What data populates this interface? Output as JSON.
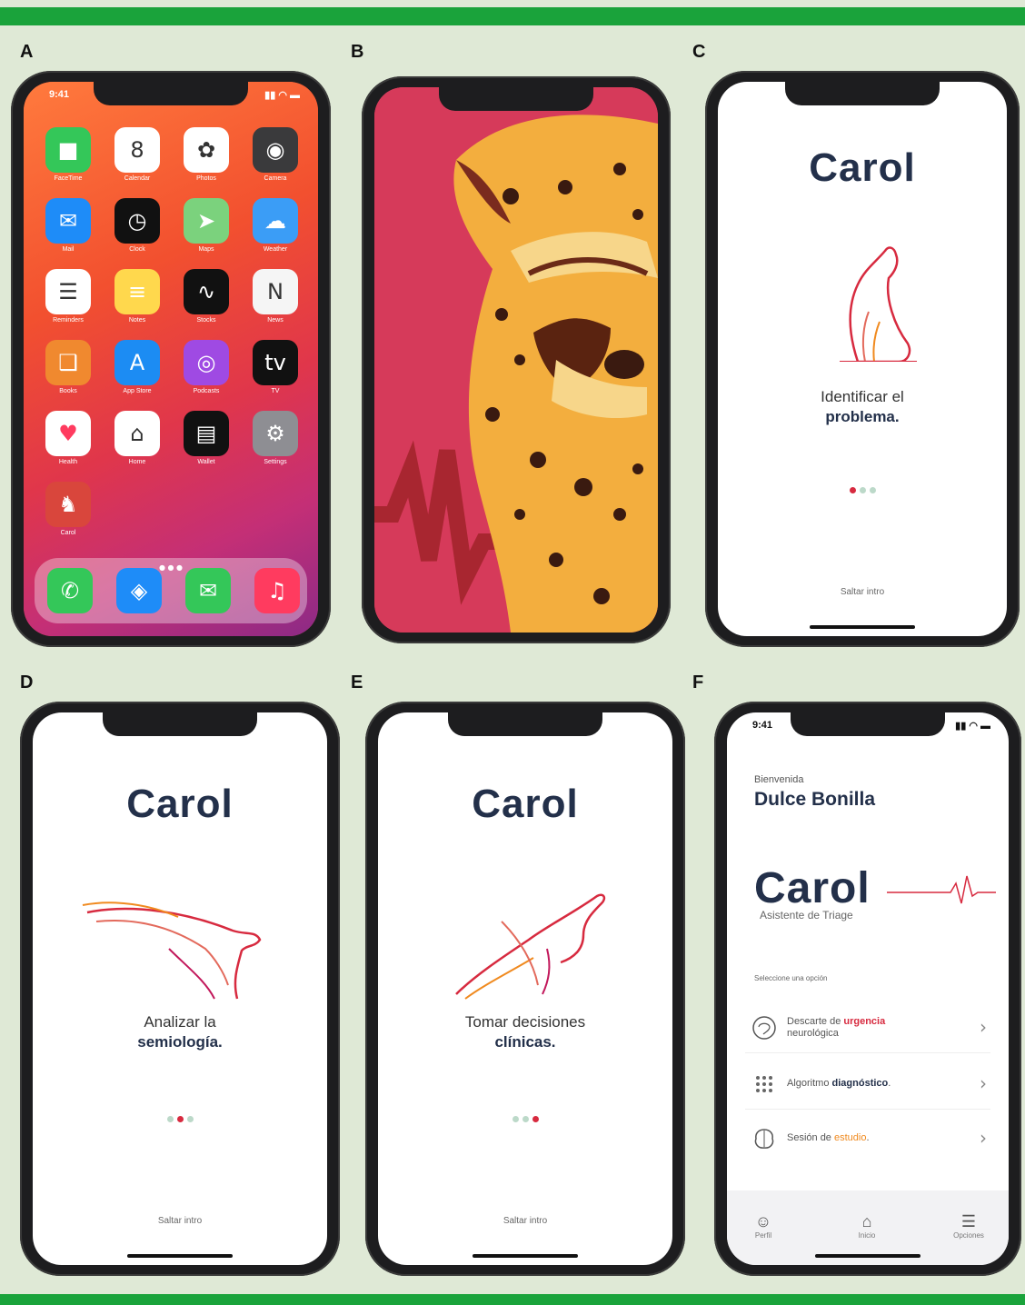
{
  "panels": {
    "a": {
      "letter": "A"
    },
    "b": {
      "letter": "B"
    },
    "c": {
      "letter": "C",
      "title": "Carol",
      "caption_line1": "Identificar el",
      "caption_line2": "problema.",
      "skip": "Saltar intro"
    },
    "d": {
      "letter": "D",
      "title": "Carol",
      "caption_line1": "Analizar la",
      "caption_line2": "semiología.",
      "skip": "Saltar intro"
    },
    "e": {
      "letter": "E",
      "title": "Carol",
      "caption_line1": "Tomar decisiones",
      "caption_line2": "clínicas.",
      "skip": "Saltar intro"
    },
    "f": {
      "letter": "F"
    }
  },
  "homescreen": {
    "time": "9:41",
    "apps": [
      {
        "label": "FaceTime",
        "icon": "video-camera-icon",
        "color": "#34c759"
      },
      {
        "label": "Calendar",
        "icon": "calendar-icon",
        "color": "#ffffff",
        "text": "8"
      },
      {
        "label": "Photos",
        "icon": "photos-icon",
        "color": "#ffffff"
      },
      {
        "label": "Camera",
        "icon": "camera-icon",
        "color": "#3a3a3c"
      },
      {
        "label": "Mail",
        "icon": "mail-icon",
        "color": "#1e8cf8"
      },
      {
        "label": "Clock",
        "icon": "clock-icon",
        "color": "#111111"
      },
      {
        "label": "Maps",
        "icon": "maps-icon",
        "color": "#7bd27d"
      },
      {
        "label": "Weather",
        "icon": "weather-icon",
        "color": "#3b9df6"
      },
      {
        "label": "Reminders",
        "icon": "reminders-icon",
        "color": "#ffffff"
      },
      {
        "label": "Notes",
        "icon": "notes-icon",
        "color": "#ffd84d"
      },
      {
        "label": "Stocks",
        "icon": "stocks-icon",
        "color": "#111111"
      },
      {
        "label": "News",
        "icon": "news-icon",
        "color": "#f5f5f5"
      },
      {
        "label": "Books",
        "icon": "books-icon",
        "color": "#f0892f"
      },
      {
        "label": "App Store",
        "icon": "app-store-icon",
        "color": "#1c8cf3"
      },
      {
        "label": "Podcasts",
        "icon": "podcasts-icon",
        "color": "#9f4ae3"
      },
      {
        "label": "TV",
        "icon": "tv-icon",
        "color": "#111111"
      },
      {
        "label": "Health",
        "icon": "health-icon",
        "color": "#ffffff"
      },
      {
        "label": "Home",
        "icon": "home-app-icon",
        "color": "#ffffff"
      },
      {
        "label": "Wallet",
        "icon": "wallet-icon",
        "color": "#111111"
      },
      {
        "label": "Settings",
        "icon": "settings-icon",
        "color": "#8e8e93"
      },
      {
        "label": "Carol",
        "icon": "carol-app-icon",
        "color": "#d9463c"
      }
    ],
    "dock": [
      {
        "icon": "phone-icon",
        "color": "#34c759"
      },
      {
        "icon": "safari-icon",
        "color": "#1e8cf8"
      },
      {
        "icon": "messages-icon",
        "color": "#34c759"
      },
      {
        "icon": "music-icon",
        "color": "#ff3b5f"
      }
    ]
  },
  "main_screen": {
    "time": "9:41",
    "greeting": "Bienvenida",
    "user_name": "Dulce Bonilla",
    "brand": "Carol",
    "subtitle": "Asistente de Triage",
    "prompt": "Seleccione una opción",
    "options": [
      {
        "pre": "Descarte de ",
        "hl": "urgencia",
        "post": "neurológica",
        "hl_color": "#d72a3f",
        "chevron": "›"
      },
      {
        "pre": "Algoritmo ",
        "hl": "diagnóstico",
        "post": ".",
        "hl_color": "#23304a",
        "chevron": "›"
      },
      {
        "pre": "Sesión de ",
        "hl": "estudio",
        "post": ".",
        "hl_color": "#f08a1f",
        "chevron": "›"
      }
    ],
    "tabs": [
      {
        "label": "Perfil",
        "icon": "person-icon"
      },
      {
        "label": "Inicio",
        "icon": "home-icon"
      },
      {
        "label": "Opciones",
        "icon": "menu-icon"
      }
    ]
  },
  "colors": {
    "frame_green": "#1aa33b",
    "background": "#dfe9d6",
    "navy": "#23304a",
    "accent_red": "#d72a3f",
    "cheetah_bg": "#d63a5a"
  }
}
